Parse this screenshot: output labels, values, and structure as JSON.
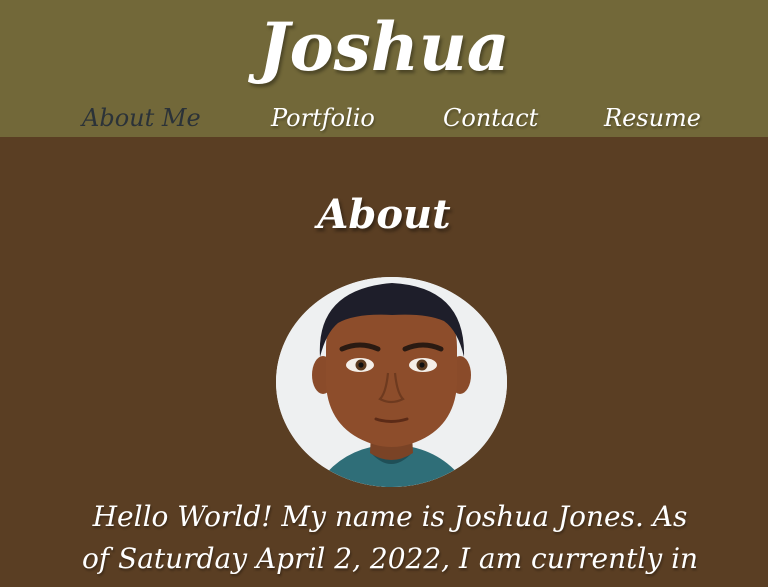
{
  "header": {
    "site_title": "Joshua",
    "nav": {
      "about": "About Me",
      "portfolio": "Portfolio",
      "contact": "Contact",
      "resume": "Resume"
    },
    "active_nav": "about"
  },
  "main": {
    "section_title": "About",
    "bio_line_1": "Hello World! My name is Joshua Jones. As",
    "bio_line_2": "of Saturday April 2, 2022, I am currently in"
  },
  "colors": {
    "header_bg": "#726839",
    "page_bg": "#5a3e23",
    "active_link": "#2b3238",
    "text": "#ffffff"
  },
  "icons": {
    "avatar": "cartoon-portrait-avatar"
  }
}
